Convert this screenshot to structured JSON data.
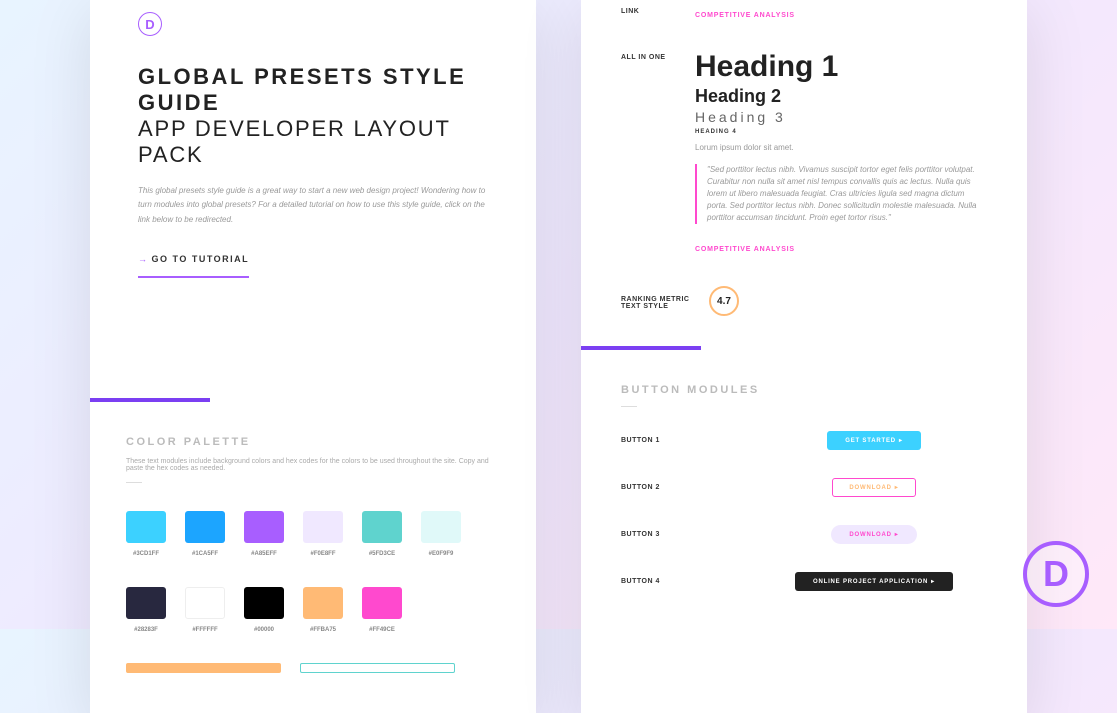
{
  "logo_letter": "D",
  "hero": {
    "title1": "GLOBAL PRESETS STYLE GUIDE",
    "title2": "APP DEVELOPER LAYOUT PACK",
    "desc": "This global presets style guide is a great way to start a new web design project! Wondering how to turn modules into global presets? For a detailed tutorial on how to use this style guide, click on the link below to be redirected.",
    "tutorial_label": "GO TO TUTORIAL"
  },
  "color_palette": {
    "title": "COLOR PALETTE",
    "sub": "These text modules include background colors and hex codes for the colors to be used throughout the site. Copy and paste the hex codes as needed.",
    "row1": [
      {
        "hex": "#3CD1FF",
        "color": "#3CD1FF"
      },
      {
        "hex": "#1CA5FF",
        "color": "#1CA5FF"
      },
      {
        "hex": "#A85EFF",
        "color": "#A85EFF"
      },
      {
        "hex": "#F0E8FF",
        "color": "#F0E8FF"
      },
      {
        "hex": "#5FD3CE",
        "color": "#5FD3CE"
      },
      {
        "hex": "#E0F9F9",
        "color": "#E0F9F9"
      }
    ],
    "row2": [
      {
        "hex": "#28283F",
        "color": "#28283F"
      },
      {
        "hex": "#FFFFFF",
        "color": "#FFFFFF"
      },
      {
        "hex": "#00000",
        "color": "#000000"
      },
      {
        "hex": "#FFBA75",
        "color": "#FFBA75"
      },
      {
        "hex": "#FF49CE",
        "color": "#FF49CE"
      }
    ]
  },
  "right": {
    "link_label": "LINK",
    "link_text": "COMPETITIVE ANALYSIS",
    "allinone": "ALL IN ONE",
    "h1": "Heading 1",
    "h2": "Heading 2",
    "h3": "Heading 3",
    "h4": "HEADING 4",
    "lorem": "Lorum ipsum dolor sit amet.",
    "quote": "\"Sed porttitor lectus nibh. Vivamus suscipit tortor eget felis porttitor volutpat. Curabitur non nulla sit amet nisl tempus convallis quis ac lectus. Nulla quis lorem ut libero malesuada feugiat. Cras ultricies ligula sed magna dictum porta. Sed porttitor lectus nibh. Donec sollicitudin molestie malesuada. Nulla porttitor accumsan tincidunt. Proin eget tortor risus.\"",
    "link_text2": "COMPETITIVE ANALYSIS",
    "metric_label": "RANKING METRIC TEXT STYLE",
    "metric_value": "4.7"
  },
  "buttons": {
    "title": "BUTTON MODULES",
    "items": [
      {
        "label": "BUTTON 1",
        "text": "GET STARTED"
      },
      {
        "label": "BUTTON 2",
        "text": "DOWNLOAD"
      },
      {
        "label": "BUTTON 3",
        "text": "DOWNLOAD"
      },
      {
        "label": "BUTTON 4",
        "text": "ONLINE PROJECT APPLICATION"
      }
    ]
  },
  "float_letter": "D"
}
